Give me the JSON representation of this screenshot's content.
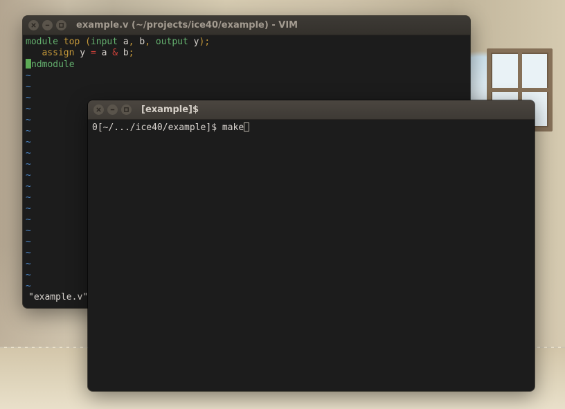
{
  "wallpaper": {
    "description": "abandoned-room-desert-sand-window"
  },
  "vim": {
    "title": "example.v (~/projects/ice40/example) - VIM",
    "code": {
      "l1": {
        "module": "module",
        "top": "top",
        "lpar": "(",
        "input": "input",
        "a": "a",
        "c1": ",",
        "b": "b",
        "c2": ",",
        "output": "output",
        "y": "y",
        "rpar_semi": ");"
      },
      "l2": {
        "indent": "   ",
        "assign": "assign",
        "y": "y",
        "eq": "=",
        "a": "a",
        "amp": "&",
        "b": "b",
        "semi": ";"
      },
      "l3": {
        "cursor_char": "e",
        "rest": "ndmodule"
      }
    },
    "tilde": "~",
    "status": "\"example.v\""
  },
  "term": {
    "title": "[example]$",
    "prompt_prefix": "0[",
    "prompt_path": "~/.../ice40/example",
    "prompt_suffix": "]$ ",
    "command": "make"
  }
}
